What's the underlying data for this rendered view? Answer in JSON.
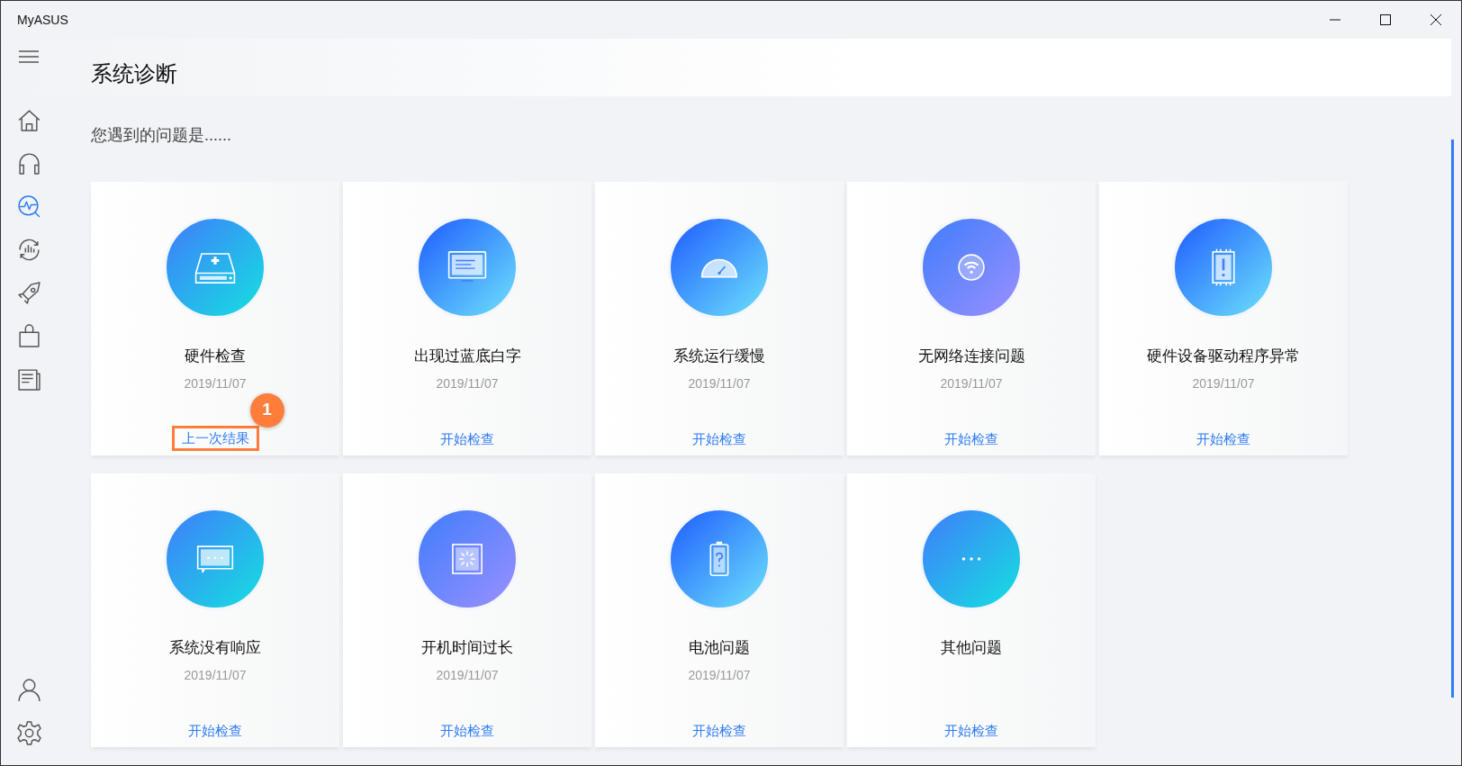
{
  "window": {
    "title": "MyASUS"
  },
  "sidebar": {
    "items": [
      {
        "selected": false
      },
      {
        "selected": false
      },
      {
        "selected": true
      },
      {
        "selected": false
      },
      {
        "selected": false
      },
      {
        "selected": false
      },
      {
        "selected": false
      }
    ],
    "bottom_items": [
      {
        "selected": false
      },
      {
        "selected": false
      }
    ]
  },
  "page": {
    "title": "系统诊断",
    "prompt": "您遇到的问题是......"
  },
  "cards": [
    {
      "title": "硬件检查",
      "date": "2019/11/07",
      "action": "上一次结果",
      "callout": "1"
    },
    {
      "title": "出现过蓝底白字",
      "date": "2019/11/07",
      "action": "开始检查"
    },
    {
      "title": "系统运行缓慢",
      "date": "2019/11/07",
      "action": "开始检查"
    },
    {
      "title": "无网络连接问题",
      "date": "2019/11/07",
      "action": "开始检查"
    },
    {
      "title": "硬件设备驱动程序异常",
      "date": "2019/11/07",
      "action": "开始检查"
    },
    {
      "title": "系统没有响应",
      "date": "2019/11/07",
      "action": "开始检查"
    },
    {
      "title": "开机时间过长",
      "date": "2019/11/07",
      "action": "开始检查"
    },
    {
      "title": "电池问题",
      "date": "2019/11/07",
      "action": "开始检查"
    },
    {
      "title": "其他问题",
      "action": "开始检查"
    }
  ]
}
